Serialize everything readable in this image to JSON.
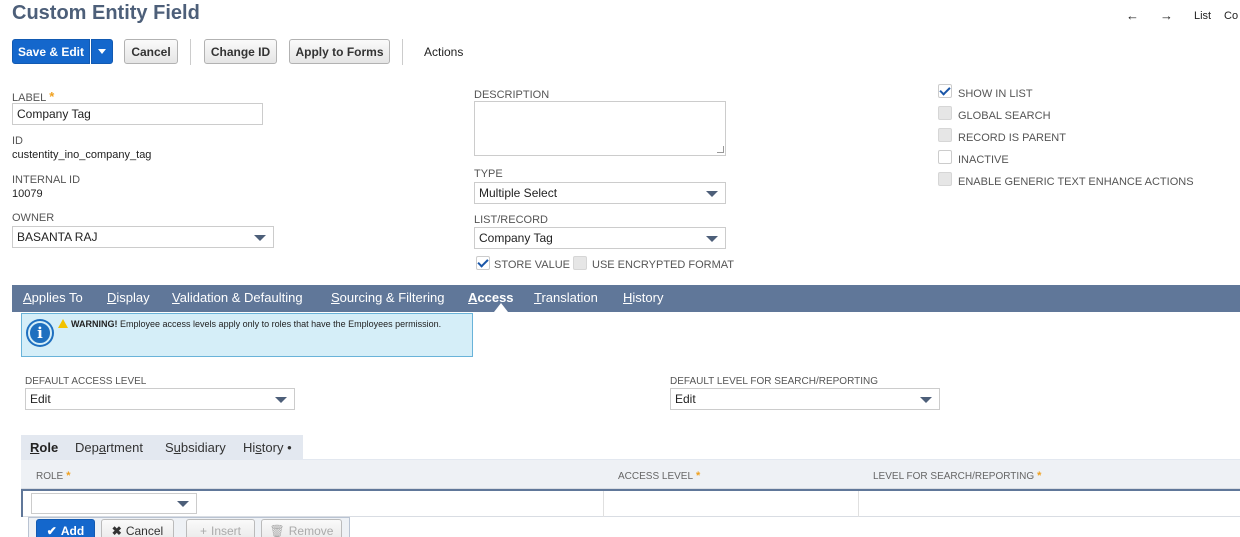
{
  "page": {
    "title": "Custom Entity Field"
  },
  "topnav": {
    "back": "←",
    "forward": "→",
    "list": "List",
    "clipped": "Co"
  },
  "toolbar": {
    "save_edit": "Save & Edit",
    "cancel": "Cancel",
    "change_id": "Change ID",
    "apply_to_forms": "Apply to Forms",
    "actions": "Actions"
  },
  "fields": {
    "label": {
      "label": "LABEL",
      "value": "Company Tag"
    },
    "id": {
      "label": "ID",
      "value": "custentity_ino_company_tag"
    },
    "internal_id": {
      "label": "INTERNAL ID",
      "value": "10079"
    },
    "owner": {
      "label": "OWNER",
      "value": "BASANTA RAJ"
    },
    "description": {
      "label": "DESCRIPTION",
      "value": ""
    },
    "type": {
      "label": "TYPE",
      "value": "Multiple Select"
    },
    "list_record": {
      "label": "LIST/RECORD",
      "value": "Company Tag"
    },
    "store_value": {
      "label": "STORE VALUE",
      "checked": true
    },
    "use_encrypted": {
      "label": "USE ENCRYPTED FORMAT",
      "checked": false
    }
  },
  "checkboxes": {
    "show_in_list": {
      "label": "SHOW IN LIST",
      "checked": true
    },
    "global_search": {
      "label": "GLOBAL SEARCH",
      "checked": false
    },
    "record_is_parent": {
      "label": "RECORD IS PARENT",
      "checked": false
    },
    "inactive": {
      "label": "INACTIVE",
      "checked": false
    },
    "enable_generic": {
      "label": "ENABLE GENERIC TEXT ENHANCE ACTIONS",
      "checked": false
    }
  },
  "tabs": {
    "applies_to": {
      "pre": "",
      "u": "A",
      "post": "pplies To"
    },
    "display": {
      "pre": "",
      "u": "D",
      "post": "isplay"
    },
    "validation": {
      "pre": "",
      "u": "V",
      "post": "alidation & Defaulting"
    },
    "sourcing": {
      "pre": "",
      "u": "S",
      "post": "ourcing & Filtering"
    },
    "access": {
      "pre": "",
      "u": "A",
      "post": "ccess"
    },
    "translation": {
      "pre": "",
      "u": "T",
      "post": "ranslation"
    },
    "history": {
      "pre": "",
      "u": "H",
      "post": "istory"
    }
  },
  "warning": {
    "title": "WARNING!",
    "text": "Employee access levels apply only to roles that have the Employees permission."
  },
  "access": {
    "default_access_label": "DEFAULT ACCESS LEVEL",
    "default_access_value": "Edit",
    "default_search_label": "DEFAULT LEVEL FOR SEARCH/REPORTING",
    "default_search_value": "Edit"
  },
  "subtabs": {
    "role": {
      "pre": "",
      "u": "R",
      "post": "ole"
    },
    "department": {
      "pre": "Dep",
      "u": "a",
      "post": "rtment"
    },
    "subsidiary": {
      "pre": "S",
      "u": "u",
      "post": "bsidiary"
    },
    "history": {
      "pre": "Hi",
      "u": "s",
      "post": "tory •"
    }
  },
  "grid": {
    "col_role": "ROLE",
    "col_access": "ACCESS LEVEL",
    "col_search": "LEVEL FOR SEARCH/REPORTING",
    "add": "Add",
    "cancel": "Cancel",
    "insert": "Insert",
    "remove": "Remove"
  }
}
